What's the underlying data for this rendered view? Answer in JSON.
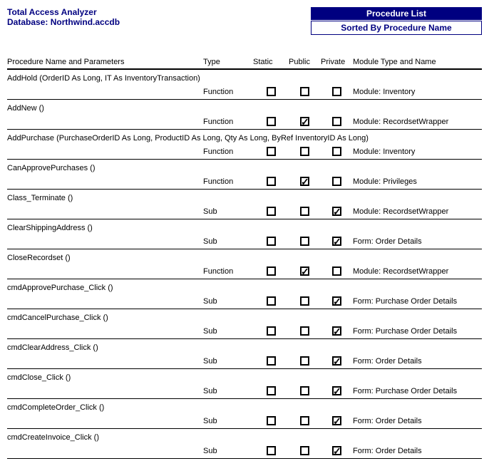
{
  "header": {
    "app_title": "Total Access Analyzer",
    "db_label": "Database:",
    "db_name": "Northwind.accdb",
    "banner_title": "Procedure List",
    "banner_subtitle": "Sorted By Procedure Name"
  },
  "columns": {
    "name": "Procedure Name and Parameters",
    "type": "Type",
    "static": "Static",
    "public": "Public",
    "private": "Private",
    "module": "Module Type and  Name"
  },
  "rows": [
    {
      "name": "AddHold (OrderID As Long, IT As InventoryTransaction)",
      "type": "Function",
      "static": false,
      "public": false,
      "private": false,
      "module": "Module: Inventory"
    },
    {
      "name": "AddNew ()",
      "type": "Function",
      "static": false,
      "public": true,
      "private": false,
      "module": "Module: RecordsetWrapper"
    },
    {
      "name": "AddPurchase (PurchaseOrderID As Long, ProductID As Long, Qty As Long, ByRef InventoryID As Long)",
      "type": "Function",
      "static": false,
      "public": false,
      "private": false,
      "module": "Module: Inventory"
    },
    {
      "name": "CanApprovePurchases ()",
      "type": "Function",
      "static": false,
      "public": true,
      "private": false,
      "module": "Module: Privileges"
    },
    {
      "name": "Class_Terminate ()",
      "type": "Sub",
      "static": false,
      "public": false,
      "private": true,
      "module": "Module: RecordsetWrapper"
    },
    {
      "name": "ClearShippingAddress ()",
      "type": "Sub",
      "static": false,
      "public": false,
      "private": true,
      "module": "Form: Order Details"
    },
    {
      "name": "CloseRecordset ()",
      "type": "Function",
      "static": false,
      "public": true,
      "private": false,
      "module": "Module: RecordsetWrapper"
    },
    {
      "name": "cmdApprovePurchase_Click ()",
      "type": "Sub",
      "static": false,
      "public": false,
      "private": true,
      "module": "Form: Purchase Order Details"
    },
    {
      "name": "cmdCancelPurchase_Click ()",
      "type": "Sub",
      "static": false,
      "public": false,
      "private": true,
      "module": "Form: Purchase Order Details"
    },
    {
      "name": "cmdClearAddress_Click ()",
      "type": "Sub",
      "static": false,
      "public": false,
      "private": true,
      "module": "Form: Order Details"
    },
    {
      "name": "cmdClose_Click ()",
      "type": "Sub",
      "static": false,
      "public": false,
      "private": true,
      "module": "Form: Purchase Order Details"
    },
    {
      "name": "cmdCompleteOrder_Click ()",
      "type": "Sub",
      "static": false,
      "public": false,
      "private": true,
      "module": "Form: Order Details"
    },
    {
      "name": "cmdCreateInvoice_Click ()",
      "type": "Sub",
      "static": false,
      "public": false,
      "private": true,
      "module": "Form: Order Details"
    }
  ]
}
